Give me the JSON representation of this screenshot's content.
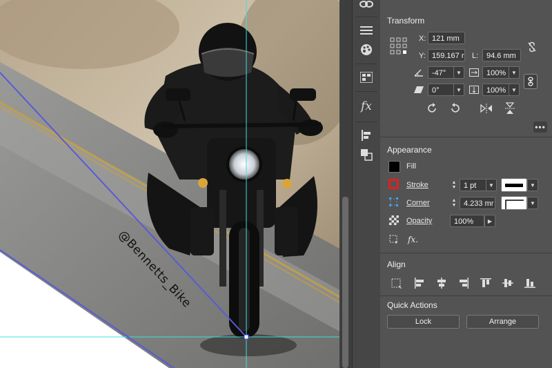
{
  "canvas": {
    "watermark": "@Bennetts_Bike"
  },
  "tool_strip": {
    "icons": [
      "links-icon",
      "hamburger-icon",
      "palette-icon",
      "grid-icon",
      "fx-icon",
      "align-left-icon",
      "pathfinder-icon"
    ],
    "fx_label": "fx"
  },
  "transform": {
    "title": "Transform",
    "x_label": "X:",
    "x_value": "121 mm",
    "y_label": "Y:",
    "y_value": "159.167 r",
    "l_label": "L:",
    "l_value": "94.6 mm",
    "rotate_value": "-47°",
    "scale_x_value": "100%",
    "shear_value": "0°",
    "scale_y_value": "100%"
  },
  "appearance": {
    "title": "Appearance",
    "fill_label": "Fill",
    "fill_color": "#000000",
    "stroke_label": "Stroke",
    "stroke_weight": "1 pt",
    "stroke_color": "#e02020",
    "corner_label": "Corner",
    "corner_value": "4.233 mr",
    "opacity_label": "Opacity",
    "opacity_value": "100%",
    "fx_label": "fx."
  },
  "align": {
    "title": "Align"
  },
  "quick_actions": {
    "title": "Quick Actions",
    "lock_label": "Lock",
    "arrange_label": "Arrange"
  },
  "colors": {
    "panel_bg": "#535353",
    "guide": "#3fe0e0",
    "path": "#5a5ad8"
  }
}
